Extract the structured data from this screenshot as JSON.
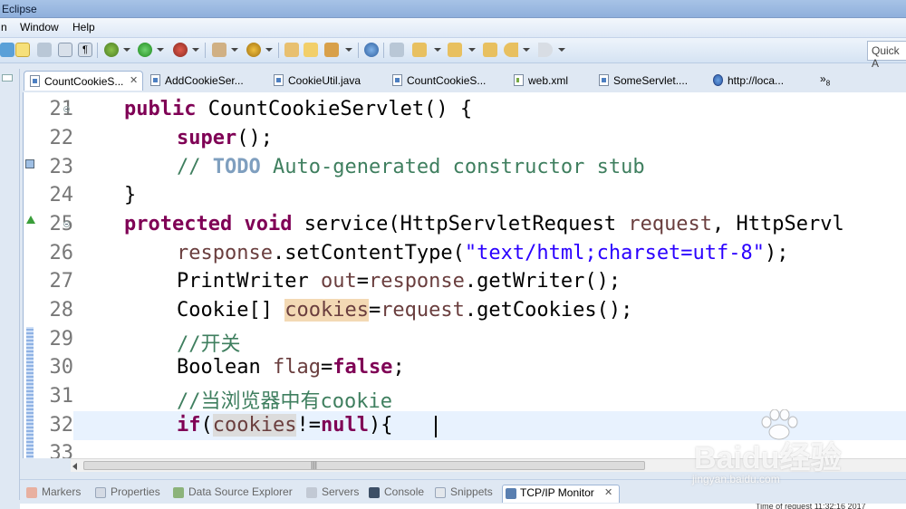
{
  "window": {
    "title": "Eclipse"
  },
  "menu": [
    "n",
    "Window",
    "Help"
  ],
  "toolbar": {
    "quick_access_placeholder": "Quick A",
    "icons": [
      "new-wizard-icon",
      "edit-mode-icon",
      "select-icon",
      "toggle-block-icon",
      "show-whitespace-icon",
      "debug-icon",
      "run-icon",
      "profile-icon",
      "external-tools-icon",
      "new-java-icon",
      "new-package-icon",
      "open-type-icon",
      "search-icon",
      "next-annotation-icon",
      "prev-annotation-icon",
      "last-edit-icon",
      "back-icon",
      "forward-icon"
    ]
  },
  "editor_tabs": [
    {
      "label": "CountCookieS...",
      "icon": "java-file-icon",
      "active": true,
      "closable": true
    },
    {
      "label": "AddCookieSer...",
      "icon": "java-file-icon"
    },
    {
      "label": "CookieUtil.java",
      "icon": "java-file-icon"
    },
    {
      "label": "CountCookieS...",
      "icon": "java-file-icon"
    },
    {
      "label": "web.xml",
      "icon": "xml-file-icon"
    },
    {
      "label": "SomeServlet....",
      "icon": "java-file-icon"
    },
    {
      "label": "http://loca...",
      "icon": "web-browser-icon"
    }
  ],
  "overflow": {
    "chevron": "»",
    "count": "8"
  },
  "editor": {
    "line_numbers": [
      "21",
      "22",
      "23",
      "24",
      "25",
      "26",
      "27",
      "28",
      "29",
      "30",
      "31",
      "32",
      "33"
    ],
    "lines": {
      "l21": {
        "kw": "public",
        "rest": " CountCookieServlet() {"
      },
      "l22": {
        "kw": "super",
        "rest": "();"
      },
      "l23": {
        "prefix": "// ",
        "todo": "TODO",
        "rest": " Auto-generated constructor stub"
      },
      "l24": {
        "text": "}"
      },
      "l25": {
        "kw1": "protected",
        "kw2": "void",
        "rest1": " service(HttpServletRequest ",
        "var": "request",
        "rest2": ", HttpServl"
      },
      "l26": {
        "var": "response",
        "rest1": ".setContentType(",
        "str": "\"text/html;charset=utf-8\"",
        "rest2": ");"
      },
      "l27": {
        "rest1": "PrintWriter ",
        "var1": "out",
        "eq": "=",
        "var2": "response",
        "rest2": ".getWriter();"
      },
      "l28": {
        "rest1": "Cookie[] ",
        "var1": "cookies",
        "eq": "=",
        "var2": "request",
        "rest2": ".getCookies();"
      },
      "l29": {
        "comment": "//开关"
      },
      "l30": {
        "rest1": "Boolean ",
        "var": "flag",
        "eq": "=",
        "kw": "false",
        "rest2": ";"
      },
      "l31": {
        "comment": "//当浏览器中有cookie"
      },
      "l32": {
        "kw": "if",
        "p1": "(",
        "var": "cookies",
        "p2": "!=",
        "kw2": "null",
        "p3": "){"
      }
    }
  },
  "bottom_views": [
    {
      "label": "Markers",
      "icon": "markers-icon"
    },
    {
      "label": "Properties",
      "icon": "properties-icon"
    },
    {
      "label": "Data Source Explorer",
      "icon": "data-source-icon"
    },
    {
      "label": "Servers",
      "icon": "servers-icon"
    },
    {
      "label": "Console",
      "icon": "console-icon"
    },
    {
      "label": "Snippets",
      "icon": "snippets-icon"
    },
    {
      "label": "TCP/IP Monitor",
      "icon": "tcpip-monitor-icon",
      "active": true,
      "closable": true
    }
  ],
  "status": {
    "text": "Time of request  11:32:16 2017"
  },
  "watermark": {
    "brand": "Baidu经验",
    "url": "jingyan.baidu.com"
  },
  "colors": {
    "keyword": "#7f0055",
    "comment": "#3f7f5f",
    "string": "#2a00ff",
    "variable": "#6a3e3e",
    "todo": "#7f9fbf",
    "current_line": "#e8f2fe"
  }
}
